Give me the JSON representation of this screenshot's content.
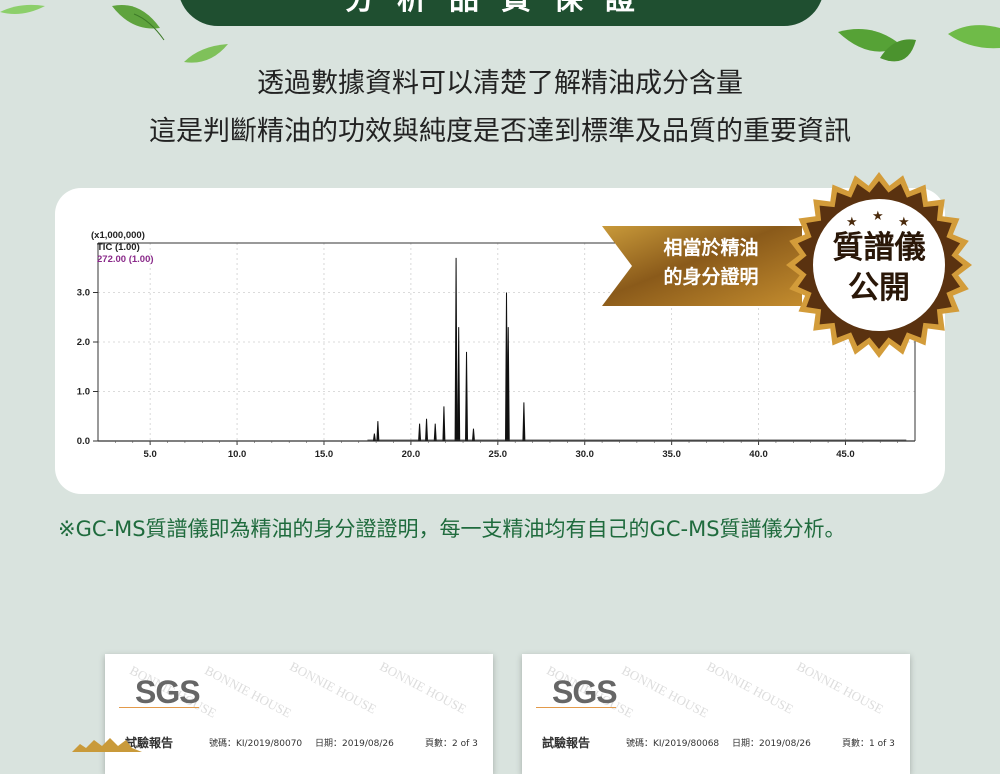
{
  "header": {
    "title": "分析品質保證"
  },
  "intro": {
    "line1": "透過數據資料可以清楚了解精油成分含量",
    "line2": "這是判斷精油的功效與純度是否達到標準及品質的重要資訊"
  },
  "ribbon": {
    "line1": "相當於精油",
    "line2": "的身分證明"
  },
  "badge": {
    "line1": "質譜儀",
    "line2": "公開"
  },
  "chart_data": {
    "type": "line",
    "scale_label": "(x1,000,000)",
    "legend": [
      "TIC (1.00)",
      "272.00 (1.00)"
    ],
    "x_ticks": [
      "5.0",
      "10.0",
      "15.0",
      "20.0",
      "25.0",
      "30.0",
      "35.0",
      "40.0",
      "45.0"
    ],
    "y_ticks": [
      "0.0",
      "1.0",
      "2.0",
      "3.0"
    ],
    "xlim": [
      2.0,
      49.0
    ],
    "ylim": [
      0.0,
      4.0
    ],
    "peaks": [
      {
        "x": 17.9,
        "y": 0.15
      },
      {
        "x": 18.1,
        "y": 0.4
      },
      {
        "x": 20.5,
        "y": 0.35
      },
      {
        "x": 20.9,
        "y": 0.45
      },
      {
        "x": 21.4,
        "y": 0.35
      },
      {
        "x": 21.9,
        "y": 0.7
      },
      {
        "x": 22.6,
        "y": 3.7
      },
      {
        "x": 22.75,
        "y": 2.3
      },
      {
        "x": 23.2,
        "y": 1.8
      },
      {
        "x": 23.6,
        "y": 0.25
      },
      {
        "x": 25.5,
        "y": 3.0
      },
      {
        "x": 25.6,
        "y": 2.3
      },
      {
        "x": 26.5,
        "y": 0.78
      }
    ]
  },
  "footnote": "※GC-MS質譜儀即為精油的身分證證明，每一支精油均有自己的GC-MS質譜儀分析。",
  "reports": [
    {
      "logo": "SGS",
      "title": "試驗報告",
      "number": "號碼：KI/2019/80070",
      "date": "日期：2019/08/26",
      "page": "頁數：2 of 3",
      "watermark": "BONNIE HOUSE"
    },
    {
      "logo": "SGS",
      "title": "試驗報告",
      "number": "號碼：KI/2019/80068",
      "date": "日期：2019/08/26",
      "page": "頁數：1 of 3",
      "watermark": "BONNIE HOUSE"
    }
  ]
}
